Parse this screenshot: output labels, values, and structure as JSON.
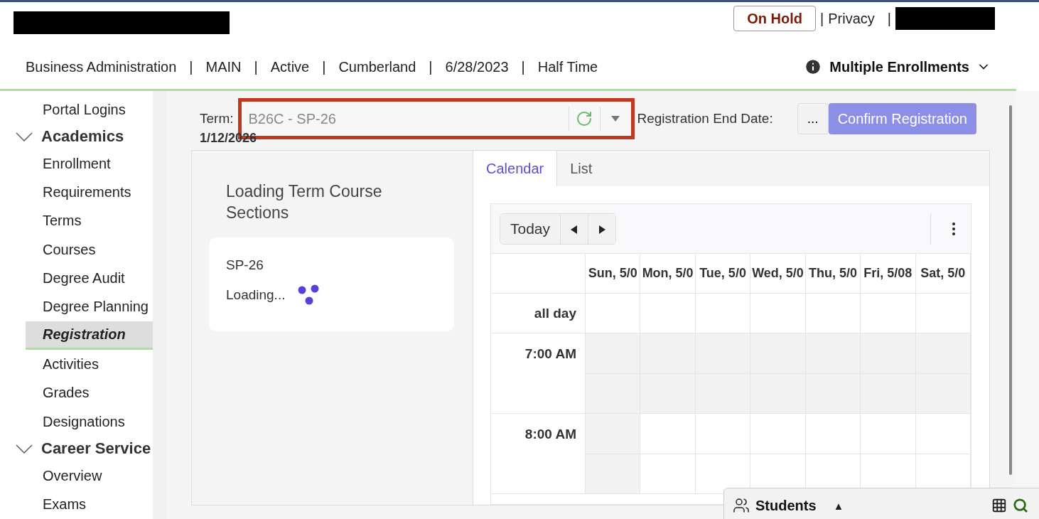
{
  "header": {
    "status_button": "On Hold",
    "privacy_link": "Privacy",
    "separators": [
      "|",
      "|"
    ]
  },
  "info_bar": {
    "items": [
      "Business Administration",
      "MAIN",
      "Active",
      "Cumberland",
      "6/28/2023",
      "Half Time"
    ],
    "separators": [
      "|",
      "|",
      "|",
      "|",
      "|"
    ],
    "enrollments": "Multiple Enrollments"
  },
  "sidebar": {
    "items": [
      {
        "kind": "item",
        "label": "Portal Logins",
        "selected": false
      },
      {
        "kind": "section",
        "label": "Academics",
        "expanded": true,
        "children": [
          {
            "label": "Enrollment",
            "selected": false
          },
          {
            "label": "Requirements",
            "selected": false
          },
          {
            "label": "Terms",
            "selected": false
          },
          {
            "label": "Courses",
            "selected": false
          },
          {
            "label": "Degree Audit",
            "selected": false
          },
          {
            "label": "Degree Planning",
            "selected": false
          },
          {
            "label": "Registration",
            "selected": true
          },
          {
            "label": "Activities",
            "selected": false
          },
          {
            "label": "Grades",
            "selected": false
          },
          {
            "label": "Designations",
            "selected": false
          }
        ]
      },
      {
        "kind": "section",
        "label": "Career Service",
        "expanded": true,
        "children": [
          {
            "label": "Overview",
            "selected": false
          },
          {
            "label": "Exams",
            "selected": false
          }
        ]
      }
    ]
  },
  "term": {
    "label": "Term:",
    "value": "B26C - SP-26",
    "end_date_label": "Registration End Date:",
    "end_date": "1/12/2026",
    "more_button": "...",
    "confirm_button": "Confirm Registration"
  },
  "loading_panel": {
    "title": "Loading Term Course Sections",
    "term": "SP-26",
    "status": "Loading..."
  },
  "tabs": [
    {
      "label": "Calendar",
      "selected": true
    },
    {
      "label": "List",
      "selected": false
    }
  ],
  "calendar": {
    "today_button": "Today",
    "days": [
      "Sun, 5/0",
      "Mon, 5/0",
      "Tue, 5/0",
      "Wed, 5/0",
      "Thu, 5/0",
      "Fri, 5/08",
      "Sat, 5/0"
    ],
    "all_day": "all day",
    "times": [
      "7:00 AM",
      "8:00 AM"
    ]
  },
  "students_panel": {
    "title": "Students",
    "caret": "▲"
  }
}
